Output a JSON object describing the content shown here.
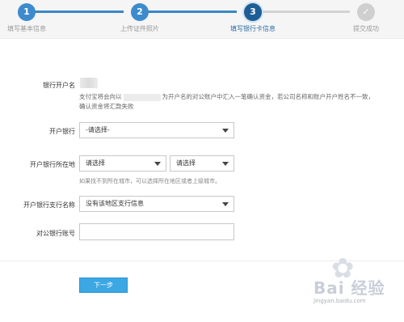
{
  "steps": [
    {
      "number": "1",
      "label": "填写基本信息",
      "state": "done"
    },
    {
      "number": "2",
      "label": "上传证件照片",
      "state": "done"
    },
    {
      "number": "3",
      "label": "填写银行卡信息",
      "state": "current"
    },
    {
      "number": "✓",
      "label": "提交成功",
      "state": "todo"
    }
  ],
  "form": {
    "account_name_label": "银行开户名",
    "info_text_part1": "支付宝将会向以",
    "info_text_part2": "为开户名的对公账户中汇入一笔确认资金，若公司名称和账户开户姓名不一致，确认资金将汇款失败",
    "bank_label": "开户银行",
    "bank_value": "-请选择-",
    "location_label": "开户银行所在地",
    "province_value": "请选择",
    "city_value": "请选择",
    "location_hint": "如果找不到所在城市，可以选择所在地区或者上级城市。",
    "branch_label": "开户银行支行名称",
    "branch_value": "没有该地区支行信息",
    "account_number_label": "对公银行账号",
    "account_number_value": "",
    "next_button": "下一步"
  },
  "watermark": {
    "brand": "Bai 经验",
    "url": "jingyan.baidu.com"
  },
  "colors": {
    "accent": "#3ba7e3",
    "step_done": "#3d8bcd",
    "step_current": "#1e5e95",
    "step_todo": "#cfcfcf"
  }
}
